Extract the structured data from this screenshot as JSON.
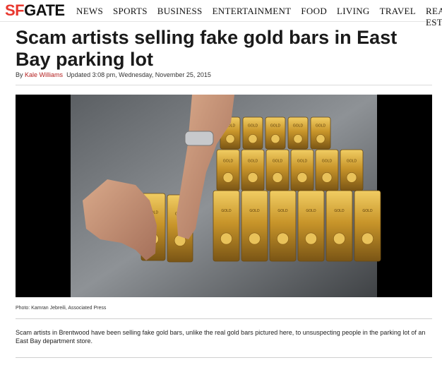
{
  "header": {
    "logo_sf": "SF",
    "logo_gate": "GATE",
    "nav": [
      "NEWS",
      "SPORTS",
      "BUSINESS",
      "ENTERTAINMENT",
      "FOOD",
      "LIVING",
      "TRAVEL",
      "REAL ESTATE"
    ]
  },
  "article": {
    "headline": "Scam artists selling fake gold bars in East Bay parking lot",
    "by_prefix": "By",
    "author": "Kale Williams",
    "updated": "Updated 3:08 pm, Wednesday, November 25, 2015",
    "photo_credit": "Photo: Kamran Jebreili, Associated Press",
    "caption": "Scam artists in Brentwood have been selling fake gold bars, unlike the real gold bars pictured here, to unsuspecting people in the parking lot of an East Bay department store.",
    "gold_bar_stamp": "GOLD"
  },
  "colors": {
    "brand_red": "#e8382f",
    "author_red": "#b41f1f",
    "gold": "#d8a930"
  }
}
